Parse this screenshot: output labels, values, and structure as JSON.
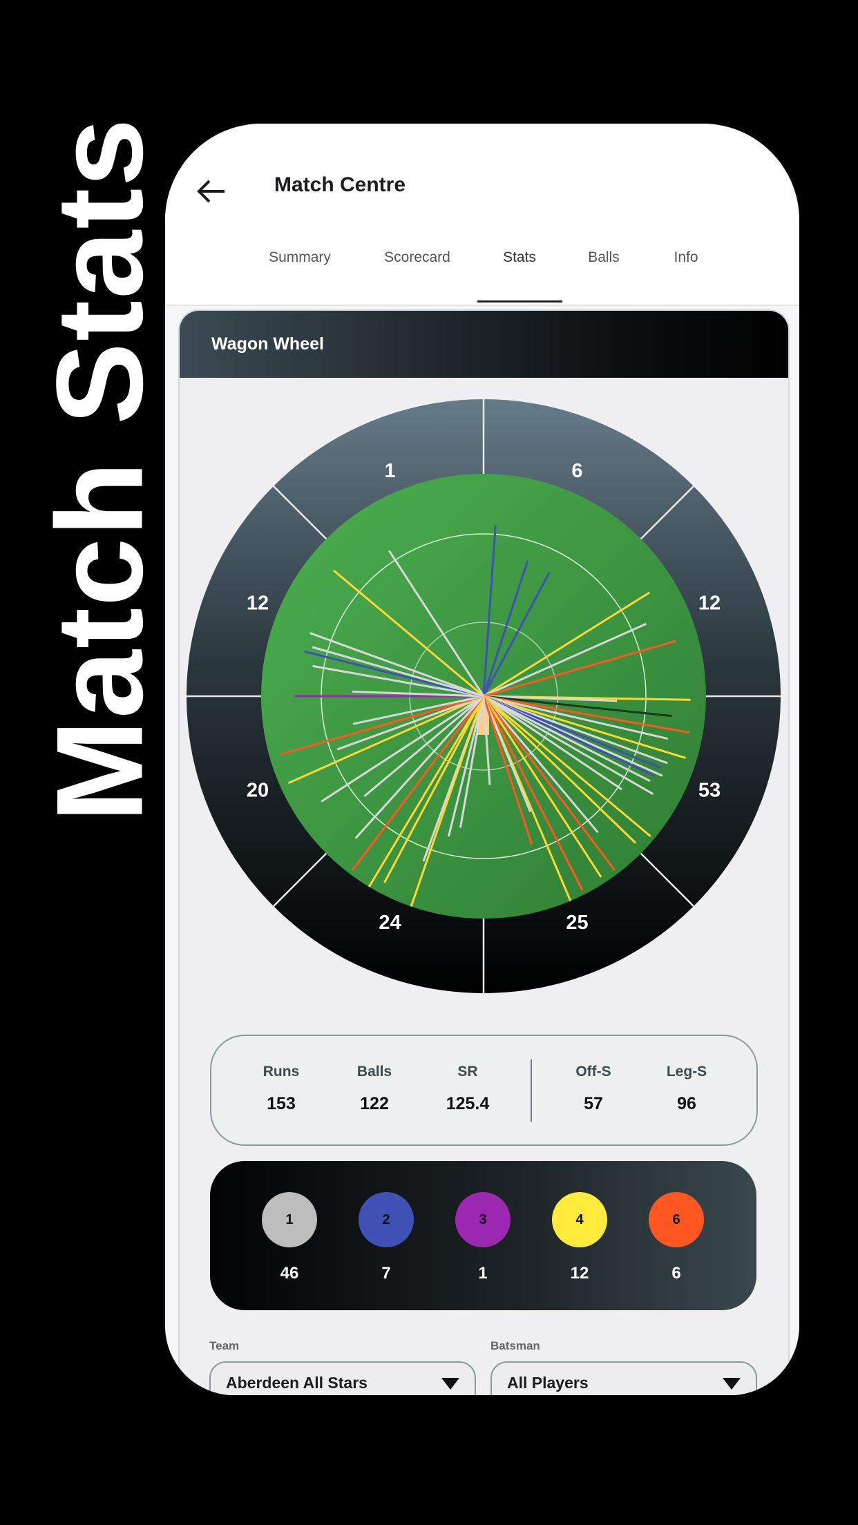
{
  "side_title": "Match Stats",
  "header": {
    "title": "Match Centre",
    "back_icon": "arrow-left-icon"
  },
  "tabs": [
    {
      "label": "Summary"
    },
    {
      "label": "Scorecard"
    },
    {
      "label": "Stats",
      "active": true
    },
    {
      "label": "Balls"
    },
    {
      "label": "Info"
    }
  ],
  "wagon_wheel": {
    "title": "Wagon Wheel",
    "segments_clockwise_from_top": [
      "6",
      "12",
      "53",
      "25",
      "24",
      "20",
      "12",
      "1"
    ],
    "run_colors": {
      "1": "#d8d8d8",
      "2": "#3f51b5",
      "3": "#9c27b0",
      "4": "#fdd835",
      "6": "#ff5722",
      "0": "#1b3a1b"
    },
    "shots": [
      {
        "angle": 4,
        "length": 0.77,
        "runs": 2
      },
      {
        "angle": 18,
        "length": 0.64,
        "runs": 2
      },
      {
        "angle": 28,
        "length": 0.63,
        "runs": 2
      },
      {
        "angle": 58,
        "length": 0.88,
        "runs": 4
      },
      {
        "angle": 66,
        "length": 0.8,
        "runs": 1
      },
      {
        "angle": 74,
        "length": 0.9,
        "runs": 6
      },
      {
        "angle": 91,
        "length": 0.93,
        "runs": 4
      },
      {
        "angle": 92,
        "length": 0.6,
        "runs": 1
      },
      {
        "angle": 96,
        "length": 0.85,
        "runs": 0
      },
      {
        "angle": 100,
        "length": 0.94,
        "runs": 6
      },
      {
        "angle": 103,
        "length": 0.85,
        "runs": 1
      },
      {
        "angle": 107,
        "length": 0.95,
        "runs": 4
      },
      {
        "angle": 110,
        "length": 0.88,
        "runs": 1
      },
      {
        "angle": 112,
        "length": 0.86,
        "runs": 2
      },
      {
        "angle": 114,
        "length": 0.88,
        "runs": 1
      },
      {
        "angle": 115,
        "length": 0.85,
        "runs": 2
      },
      {
        "angle": 117,
        "length": 0.84,
        "runs": 1
      },
      {
        "angle": 120,
        "length": 0.88,
        "runs": 1
      },
      {
        "angle": 124,
        "length": 0.75,
        "runs": 1
      },
      {
        "angle": 130,
        "length": 0.98,
        "runs": 4
      },
      {
        "angle": 134,
        "length": 0.95,
        "runs": 4
      },
      {
        "angle": 140,
        "length": 0.8,
        "runs": 1
      },
      {
        "angle": 143,
        "length": 0.98,
        "runs": 6
      },
      {
        "angle": 147,
        "length": 0.97,
        "runs": 4
      },
      {
        "angle": 153,
        "length": 0.98,
        "runs": 6
      },
      {
        "angle": 157,
        "length": 1.0,
        "runs": 4
      },
      {
        "angle": 158,
        "length": 0.56,
        "runs": 1
      },
      {
        "angle": 162,
        "length": 0.7,
        "runs": 6
      },
      {
        "angle": 176,
        "length": 0.4,
        "runs": 1
      },
      {
        "angle": 190,
        "length": 0.6,
        "runs": 1
      },
      {
        "angle": 194,
        "length": 0.65,
        "runs": 1
      },
      {
        "angle": 200,
        "length": 0.79,
        "runs": 1
      },
      {
        "angle": 199,
        "length": 1.0,
        "runs": 4
      },
      {
        "angle": 208,
        "length": 0.95,
        "runs": 4
      },
      {
        "angle": 211,
        "length": 1.0,
        "runs": 4
      },
      {
        "angle": 217,
        "length": 0.98,
        "runs": 6
      },
      {
        "angle": 222,
        "length": 0.86,
        "runs": 1
      },
      {
        "angle": 230,
        "length": 0.7,
        "runs": 1
      },
      {
        "angle": 237,
        "length": 0.87,
        "runs": 1
      },
      {
        "angle": 246,
        "length": 0.96,
        "runs": 4
      },
      {
        "angle": 250,
        "length": 0.7,
        "runs": 1
      },
      {
        "angle": 254,
        "length": 0.95,
        "runs": 6
      },
      {
        "angle": 258,
        "length": 0.6,
        "runs": 1
      },
      {
        "angle": 270,
        "length": 0.85,
        "runs": 3
      },
      {
        "angle": 272,
        "length": 0.59,
        "runs": 1
      },
      {
        "angle": 280,
        "length": 0.78,
        "runs": 1
      },
      {
        "angle": 284,
        "length": 0.83,
        "runs": 2
      },
      {
        "angle": 286,
        "length": 0.8,
        "runs": 1
      },
      {
        "angle": 290,
        "length": 0.83,
        "runs": 1
      },
      {
        "angle": 310,
        "length": 0.88,
        "runs": 4
      },
      {
        "angle": 327,
        "length": 0.78,
        "runs": 1
      }
    ]
  },
  "summary": {
    "left": [
      {
        "label": "Runs",
        "value": "153"
      },
      {
        "label": "Balls",
        "value": "122"
      },
      {
        "label": "SR",
        "value": "125.4"
      }
    ],
    "right": [
      {
        "label": "Off-S",
        "value": "57"
      },
      {
        "label": "Leg-S",
        "value": "96"
      }
    ]
  },
  "run_counts": [
    {
      "runs": "1",
      "count": "46",
      "color": "#bdbdbd"
    },
    {
      "runs": "2",
      "count": "7",
      "color": "#3f51b5"
    },
    {
      "runs": "3",
      "count": "1",
      "color": "#9c27b0"
    },
    {
      "runs": "4",
      "count": "12",
      "color": "#ffeb3b"
    },
    {
      "runs": "6",
      "count": "6",
      "color": "#ff5722"
    }
  ],
  "filters": {
    "team": {
      "label": "Team",
      "value": "Aberdeen All Stars"
    },
    "batsman": {
      "label": "Batsman",
      "value": "All Players"
    }
  }
}
